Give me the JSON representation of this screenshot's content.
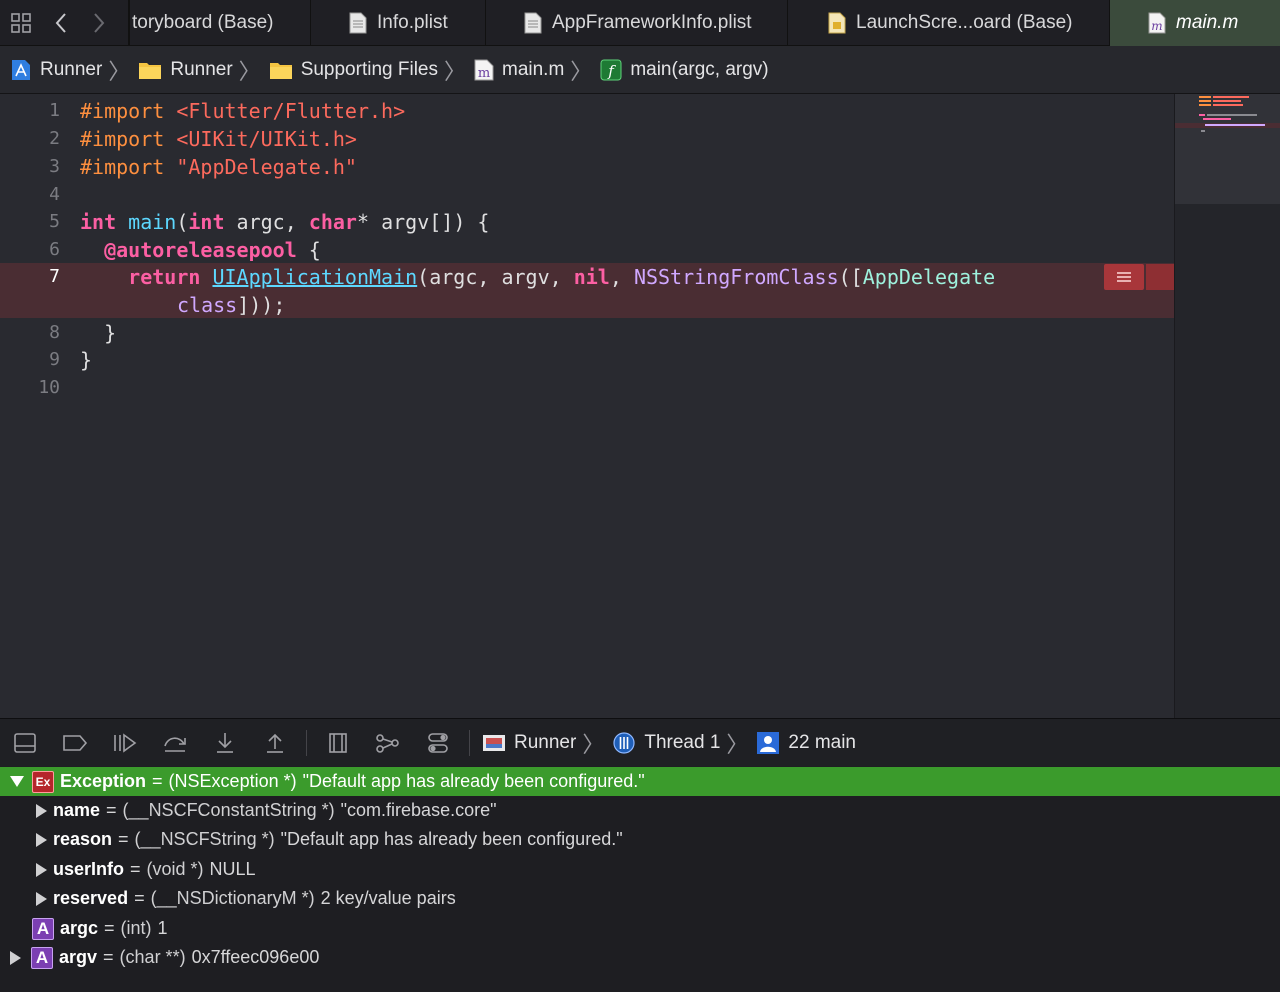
{
  "tabbar": {
    "tabs": [
      {
        "label": "toryboard (Base)",
        "icon": "storyboard-icon"
      },
      {
        "label": "Info.plist",
        "icon": "plist-file-icon"
      },
      {
        "label": "AppFrameworkInfo.plist",
        "icon": "plist-file-icon"
      },
      {
        "label": "LaunchScre...oard (Base)",
        "icon": "storyboard-file-icon"
      },
      {
        "label": "main.m",
        "icon": "objc-file-icon",
        "active": true
      }
    ]
  },
  "jumpbar": {
    "crumbs": [
      "Runner",
      "Runner",
      "Supporting Files",
      "main.m",
      "main(argc, argv)"
    ],
    "file_badge": "m",
    "func_badge": "f"
  },
  "editor": {
    "line_numbers": [
      "1",
      "2",
      "3",
      "4",
      "5",
      "6",
      "7",
      "8",
      "9",
      "10"
    ],
    "lines": {
      "l1_kw": "#import",
      "l1_val": "<Flutter/Flutter.h>",
      "l2_kw": "#import",
      "l2_val": "<UIKit/UIKit.h>",
      "l3_kw": "#import",
      "l3_val": "\"AppDelegate.h\"",
      "l5_t1": "int",
      "l5_fn": "main",
      "l5_p1": "(",
      "l5_t2": "int",
      "l5_p2": " argc, ",
      "l5_t3": "char",
      "l5_p3": "* argv[]) {",
      "l6_kw": "@autoreleasepool",
      "l6_p": " {",
      "l7_kw": "return",
      "l7_fn": "UIApplicationMain",
      "l7_p1": "(argc, argv, ",
      "l7_nil": "nil",
      "l7_p2": ", ",
      "l7_fn2": "NSStringFromClass",
      "l7_p3": "([",
      "l7_cls": "AppDelegate",
      "l7b_kw": "class",
      "l7b_p": "]));",
      "l8": "}",
      "l9": "}"
    },
    "error_line": "7"
  },
  "colors": {
    "keyword": "#fc5fa3",
    "preprocessor": "#fd8f3f",
    "string": "#fc6a5d",
    "function": "#5dd8ff",
    "exception_row": "#3b9b2c",
    "error_line_bg": "#4a2d33"
  },
  "debugbar": {
    "path": [
      "Runner",
      "Thread 1",
      "22 main"
    ]
  },
  "variables": {
    "rows": [
      {
        "badge": "Ex",
        "name": "Exception",
        "type": "(NSException *)",
        "value": "\"Default app has already been configured.\""
      },
      {
        "name": "name",
        "type": "(__NSCFConstantString *)",
        "value": "\"com.firebase.core\""
      },
      {
        "name": "reason",
        "type": "(__NSCFString *)",
        "value": "\"Default app has already been configured.\""
      },
      {
        "name": "userInfo",
        "type": "(void *)",
        "value": "NULL"
      },
      {
        "name": "reserved",
        "type": "(__NSDictionaryM *)",
        "value": "2 key/value pairs"
      },
      {
        "badge": "A",
        "name": "argc",
        "type": "(int)",
        "value": "1"
      },
      {
        "badge": "A",
        "name": "argv",
        "type": "(char **)",
        "value": "0x7ffeec096e00"
      }
    ],
    "equals": "="
  }
}
